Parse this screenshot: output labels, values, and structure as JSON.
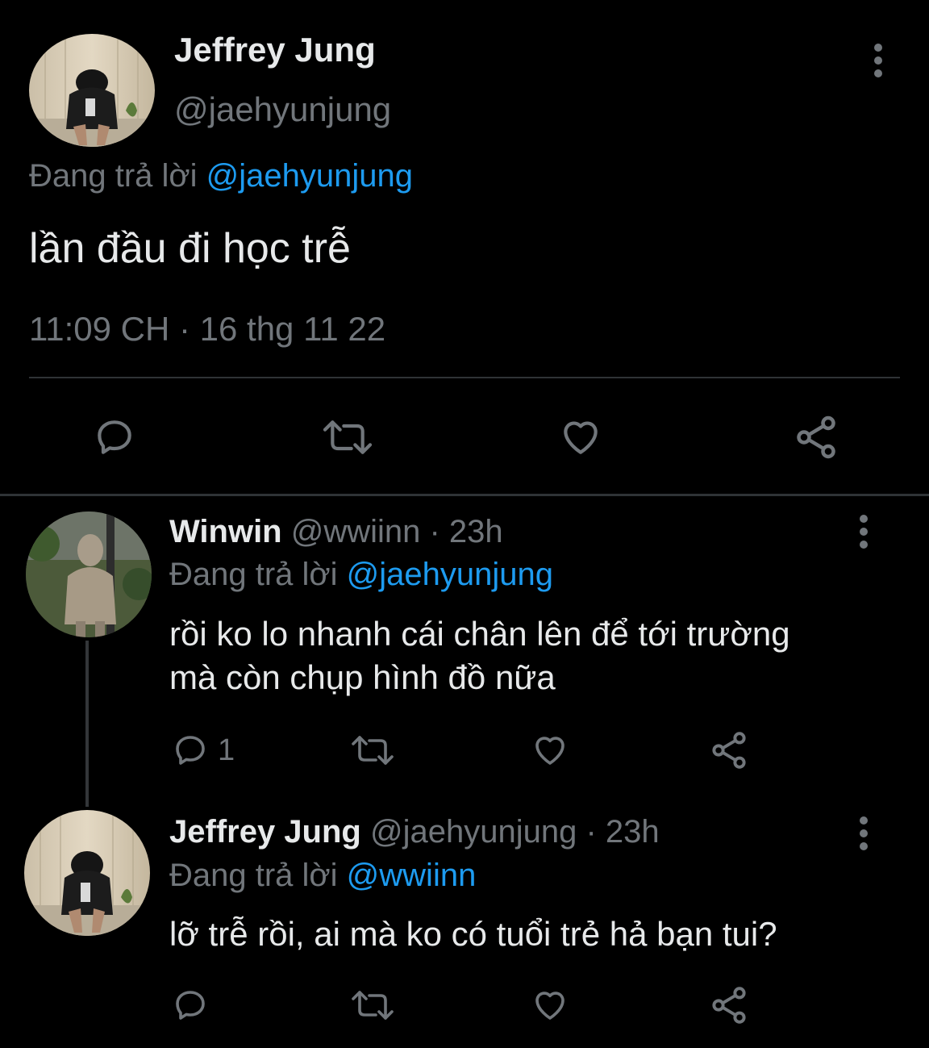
{
  "main_tweet": {
    "author_name": "Jeffrey Jung",
    "author_handle": "@jaehyunjung",
    "reply_prefix": "Đang trả lời",
    "reply_to": "@jaehyunjung",
    "text": "lần đầu đi học trễ",
    "timestamp": "11:09 CH · 16 thg 11 22"
  },
  "replies": [
    {
      "author_name": "Winwin",
      "meta": "@wwiinn · 23h",
      "reply_prefix": "Đang trả lời",
      "reply_to": "@jaehyunjung",
      "text_line1": "rồi ko lo nhanh cái chân lên để tới trường",
      "text_line2": "mà còn chụp hình đồ nữa",
      "reply_count": "1"
    },
    {
      "author_name": "Jeffrey Jung",
      "meta": "@jaehyunjung · 23h",
      "reply_prefix": "Đang trả lời",
      "reply_to": "@wwiinn",
      "text_line1": "lỡ trễ rồi, ai mà ko có tuổi trẻ hả bạn tui?"
    }
  ],
  "colors": {
    "background": "#000000",
    "text": "#e7e9ea",
    "muted": "#71767b",
    "link": "#1d9bf0",
    "divider": "#2f3336"
  },
  "icons": [
    "more-icon",
    "reply-icon",
    "retweet-icon",
    "like-icon",
    "share-icon"
  ]
}
